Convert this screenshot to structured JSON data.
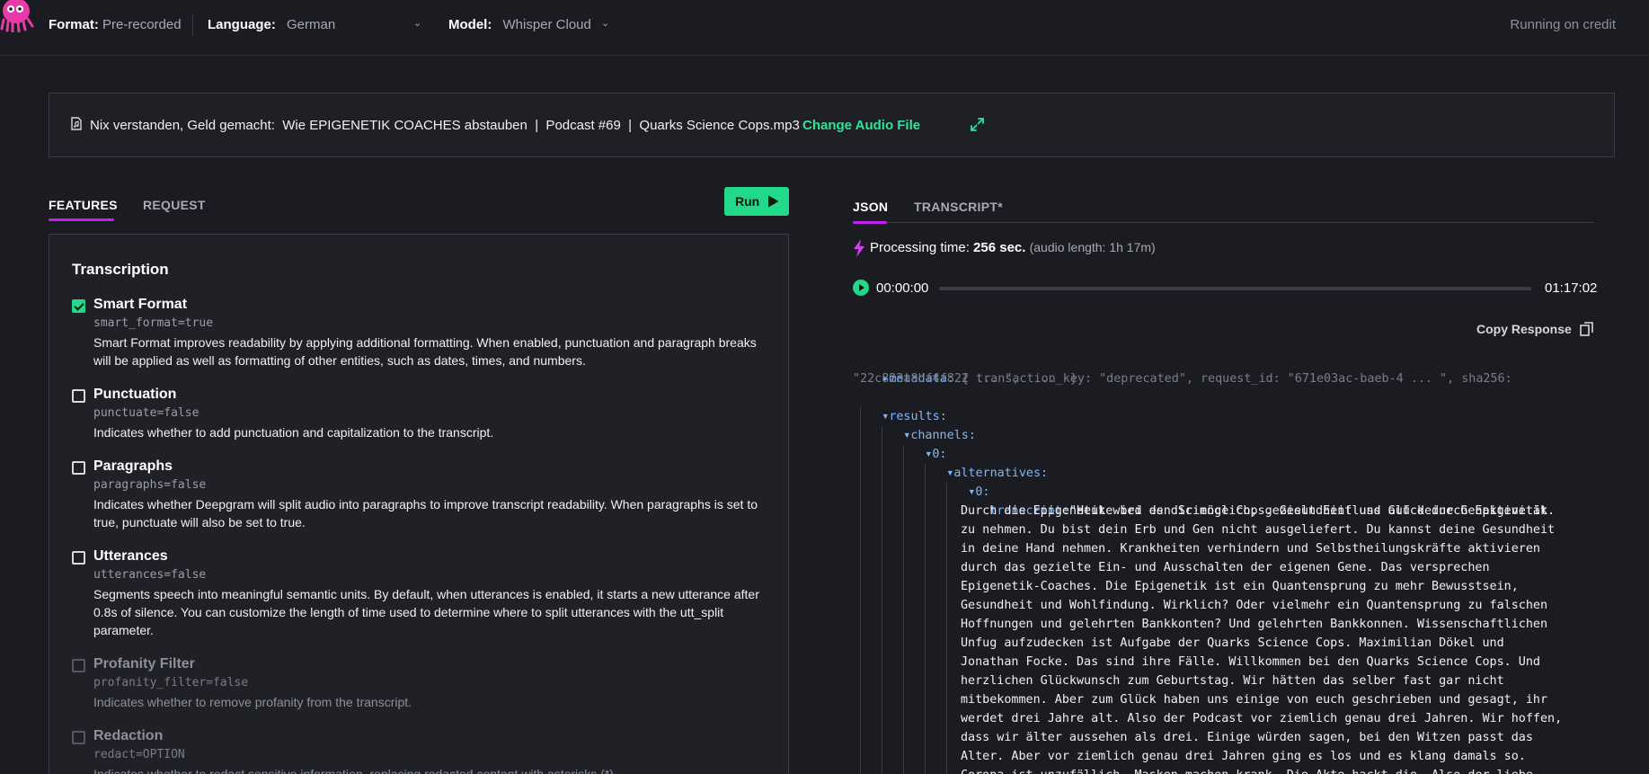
{
  "header": {
    "format_label": "Format:",
    "format_value": "Pre-recorded",
    "language_label": "Language:",
    "language_value": "German",
    "model_label": "Model:",
    "model_value": "Whisper Cloud",
    "status": "Running on credit"
  },
  "file": {
    "name": "Nix verstanden, Geld gemacht:  Wie EPIGENETIK COACHES abstauben  |  Podcast #69  |  Quarks Science Cops.mp3",
    "change_label": "Change Audio File"
  },
  "left_tabs": [
    "FEATURES",
    "REQUEST"
  ],
  "run_label": "Run",
  "features": {
    "section_title": "Transcription",
    "items": [
      {
        "name": "Smart Format",
        "code": "smart_format=true",
        "checked": true,
        "disabled": false,
        "desc": "Smart Format improves readability by applying additional formatting. When enabled, punctuation and paragraph breaks will be applied as well as formatting of other entities, such as dates, times, and numbers."
      },
      {
        "name": "Punctuation",
        "code": "punctuate=false",
        "checked": false,
        "disabled": false,
        "desc": "Indicates whether to add punctuation and capitalization to the transcript."
      },
      {
        "name": "Paragraphs",
        "code": "paragraphs=false",
        "checked": false,
        "disabled": false,
        "desc": "Indicates whether Deepgram will split audio into paragraphs to improve transcript readability. When paragraphs is set to true, punctuate will also be set to true."
      },
      {
        "name": "Utterances",
        "code": "utterances=false",
        "checked": false,
        "disabled": false,
        "desc": "Segments speech into meaningful semantic units. By default, when utterances is enabled, it starts a new utterance after 0.8s of silence. You can customize the length of time used to determine where to split utterances with the utt_split parameter."
      },
      {
        "name": "Profanity Filter",
        "code": "profanity_filter=false",
        "checked": false,
        "disabled": true,
        "desc": "Indicates whether to remove profanity from the transcript."
      },
      {
        "name": "Redaction",
        "code": "redact=OPTION",
        "checked": false,
        "disabled": true,
        "desc": "Indicates whether to redact sensitive information, replacing redacted content with asterisks (*)."
      }
    ]
  },
  "right_tabs": [
    "JSON",
    "TRANSCRIPT*"
  ],
  "processing": {
    "label": "Processing time:",
    "value": "256 sec.",
    "audio_length": "(audio length: 1h 17m)"
  },
  "audio": {
    "current": "00:00:00",
    "duration": "01:17:02",
    "progress": 0
  },
  "copy_label": "Copy Response",
  "json_view": {
    "metadata_key": "metadata:",
    "metadata_line1": "{ transaction_key: \"deprecated\", request_id: \"671e03ac-baeb-4 ... \", sha256:",
    "metadata_line2": "\"22c823a8bf4f822 ... \",  ...  }",
    "results_key": "results:",
    "channels_key": "channels:",
    "index0_key": "0:",
    "alternatives_key": "alternatives:",
    "alt0_key": "0:",
    "transcript_key": "transcript:",
    "transcript_first": "\"Heute bei den Science Cops. Gesundheit und Glück durch Epigenetik.",
    "transcript_rest": "Durch die Epigenetik wird es dir möglich, gezielt Einfluss auf deine Genaktivität\nzu nehmen. Du bist dein Erb und Gen nicht ausgeliefert. Du kannst deine Gesundheit\nin deine Hand nehmen. Krankheiten verhindern und Selbstheilungskräfte aktivieren\ndurch das gezielte Ein- und Ausschalten der eigenen Gene. Das versprechen\nEpigenetik-Coaches. Die Epigenetik ist ein Quantensprung zu mehr Bewusstsein,\nGesundheit und Wohlfindung. Wirklich? Oder vielmehr ein Quantensprung zu falschen\nHoffnungen und gelehrten Bankkonten? Und gelehrten Bankkonnen. Wissenschaftlichen\nUnfug aufzudecken ist Aufgabe der Quarks Science Cops. Maximilian Dökel und\nJonathan Focke. Das sind ihre Fälle. Willkommen bei den Quarks Science Cops. Und\nherzlichen Glückwunsch zum Geburtstag. Wir hätten das selber fast gar nicht\nmitbekommen. Aber zum Glück haben uns einige von euch geschrieben und gesagt, ihr\nwerdet drei Jahre alt. Also der Podcast vor ziemlich genau drei Jahren. Wir hoffen,\ndass wir älter aussehen als drei. Einige würden sagen, bei den Witzen passt das\nAlter. Aber vor ziemlich genau drei Jahren ging es los und es klang damals so.\nCorona ist unzufällich. Masken machen krank. Die Akte hackt die. Also der liebe"
  }
}
